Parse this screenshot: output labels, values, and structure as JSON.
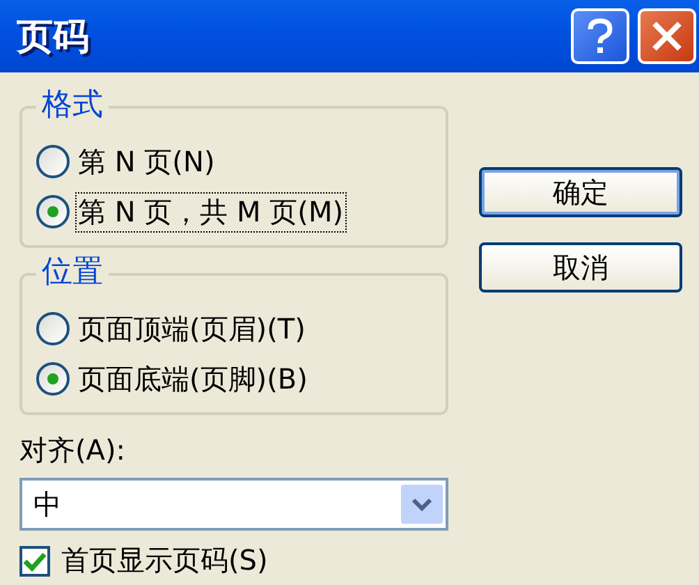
{
  "window": {
    "title": "页码"
  },
  "format_group": {
    "title": "格式",
    "options": [
      {
        "label": "第 N 页(N)",
        "selected": false,
        "focused": false
      },
      {
        "label": "第 N 页，共 M 页(M)",
        "selected": true,
        "focused": true
      }
    ]
  },
  "position_group": {
    "title": "位置",
    "options": [
      {
        "label": "页面顶端(页眉)(T)",
        "selected": false,
        "focused": false
      },
      {
        "label": "页面底端(页脚)(B)",
        "selected": true,
        "focused": false
      }
    ]
  },
  "alignment": {
    "label": "对齐(A):",
    "value": "中"
  },
  "first_page": {
    "label": "首页显示页码(S)",
    "checked": true
  },
  "buttons": [
    {
      "label": "确定",
      "default": true
    },
    {
      "label": "取消",
      "default": false
    }
  ]
}
